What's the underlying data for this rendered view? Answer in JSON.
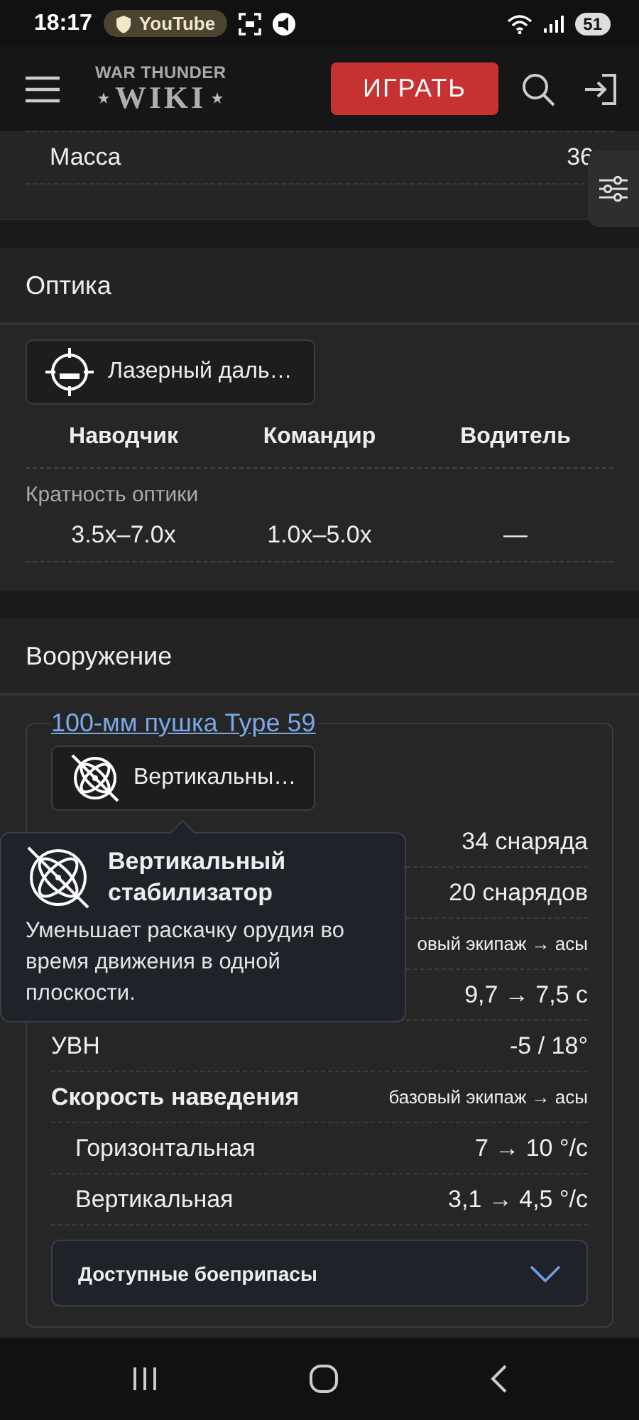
{
  "status_bar": {
    "time": "18:17",
    "app_pill": "YouTube",
    "battery": "51"
  },
  "header": {
    "logo_top": "WAR THUNDER",
    "logo_main": "WIKI",
    "play_button": "ИГРАТЬ"
  },
  "partial_section": {
    "rows": [
      {
        "label": "Масса",
        "value": "36"
      }
    ]
  },
  "sections": [
    {
      "kind": "optics",
      "title": "Оптика",
      "feature": {
        "kind": "rangefinder",
        "label": "Лазерный даль…"
      },
      "columns": [
        "Наводчик",
        "Командир",
        "Водитель"
      ],
      "rows": [
        {
          "label": "Кратность оптики",
          "values": [
            "3.5x–7.0x",
            "1.0x–5.0x",
            "—"
          ]
        }
      ]
    },
    {
      "kind": "armament",
      "title": "Вооружение",
      "weapon_link": "100-мм пушка Type 59",
      "feature": {
        "kind": "stabilizer",
        "label": "Вертикальны…"
      },
      "rows": [
        {
          "kind": "stat",
          "value": "34 снаряда"
        },
        {
          "kind": "stat",
          "value": "20 снарядов"
        },
        {
          "kind": "group",
          "value": "овый экипаж → асы"
        },
        {
          "kind": "stat",
          "value": "9,7 → 7,5 с"
        },
        {
          "kind": "stat",
          "label": "УВН",
          "value": "-5 / 18°"
        },
        {
          "kind": "group",
          "label": "Скорость наведения",
          "value": "базовый экипаж → асы"
        },
        {
          "kind": "sub",
          "label": "Горизонтальная",
          "value": "7 → 10 °/с"
        },
        {
          "kind": "sub",
          "label": "Вертикальная",
          "value": "3,1 → 4,5 °/с"
        }
      ],
      "accordion": {
        "label": "Доступные боеприпасы",
        "expanded": false
      }
    }
  ],
  "tooltip": {
    "kind": "stabilizer",
    "title": "Вертикальный стабилизатор",
    "text": "Уменьшает раскачку орудия во время движения в одной плоскости."
  }
}
